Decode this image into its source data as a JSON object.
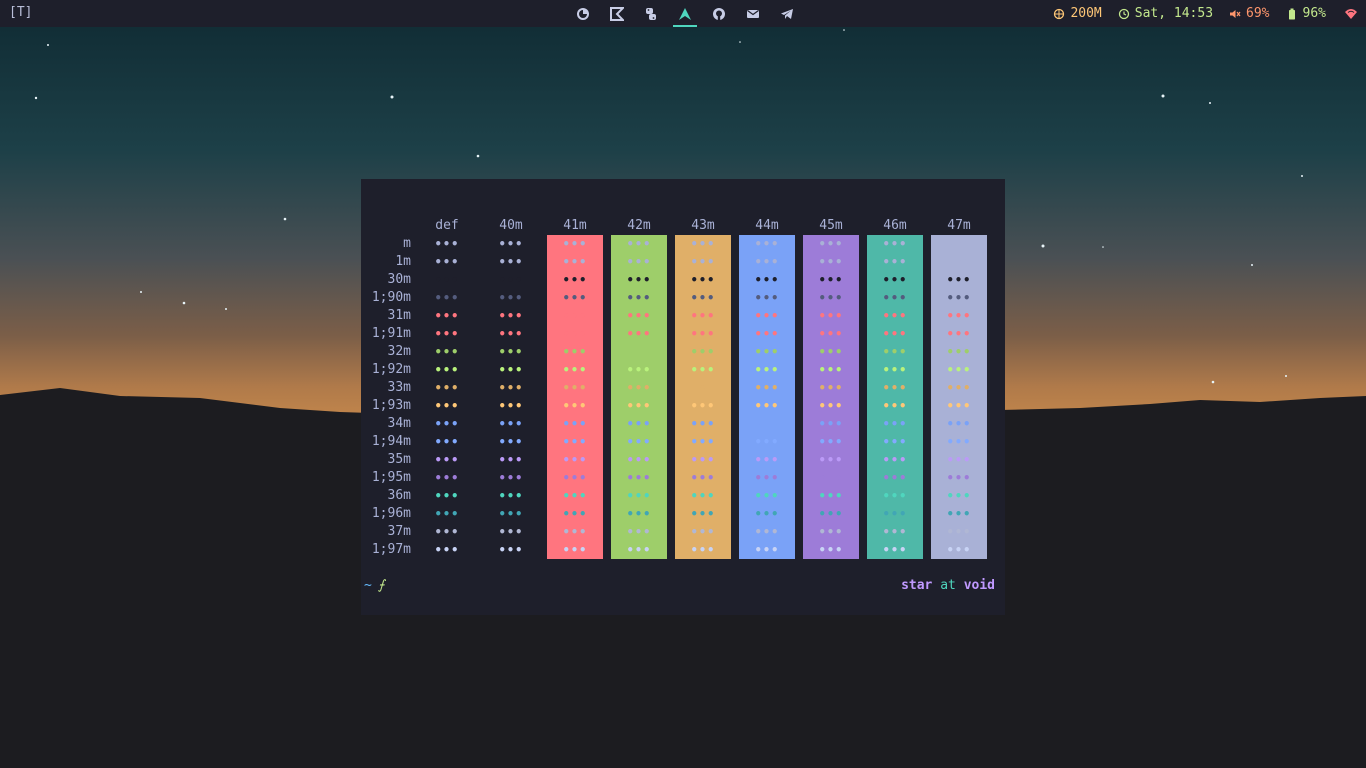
{
  "topbar": {
    "workspace": "[T]",
    "apps": [
      {
        "name": "firefox-icon",
        "active": false
      },
      {
        "name": "kotlin-icon",
        "active": false
      },
      {
        "name": "python-icon",
        "active": false
      },
      {
        "name": "arch-icon",
        "active": true
      },
      {
        "name": "github-icon",
        "active": false
      },
      {
        "name": "mail-icon",
        "active": false
      },
      {
        "name": "telegram-icon",
        "active": false
      }
    ],
    "status": {
      "memory": "200M",
      "clock": "Sat, 14:53",
      "volume": "69%",
      "battery": "96%"
    }
  },
  "terminal": {
    "columns": [
      "def",
      "40m",
      "41m",
      "42m",
      "43m",
      "44m",
      "45m",
      "46m",
      "47m"
    ],
    "rows": [
      "m",
      "1m",
      "30m",
      "1;90m",
      "31m",
      "1;91m",
      "32m",
      "1;92m",
      "33m",
      "1;93m",
      "34m",
      "1;94m",
      "35m",
      "1;95m",
      "36m",
      "1;96m",
      "37m",
      "1;97m"
    ],
    "cell_text": "•••",
    "bg_colors": [
      null,
      null,
      "#ff757f",
      "#9ece6a",
      "#e0af68",
      "#7aa2f7",
      "#9d7cd8",
      "#4fb8a8",
      "#a9b1d6"
    ],
    "fg_colors": [
      "#a9b1d6",
      "#a9b1d6",
      "#1e1f2b",
      "#545c7e",
      "#ff757f",
      "#ff757f",
      "#9ece6a",
      "#b9f27c",
      "#e0af68",
      "#ffc777",
      "#7aa2f7",
      "#82aaff",
      "#bb9af7",
      "#9d7cd8",
      "#4fd6be",
      "#41a6b5",
      "#b0b7d4",
      "#c8d3f5"
    ],
    "prompt": {
      "path": "~",
      "symbol": "⨍"
    },
    "right_prompt": {
      "user": "star",
      "at": "at",
      "host": "void"
    }
  },
  "colors": {
    "accent": "#4fd6be",
    "bar_bg": "#1e1f2b"
  }
}
